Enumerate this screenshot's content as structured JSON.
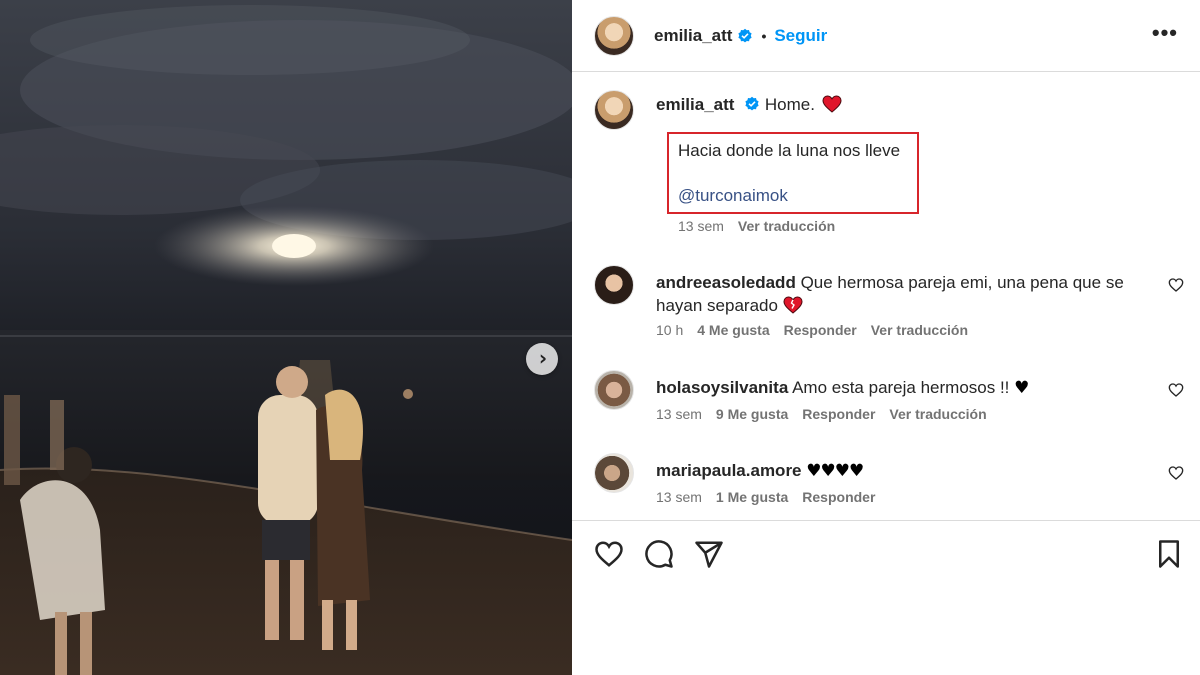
{
  "post": {
    "username": "emilia_att",
    "follow_label": "Seguir",
    "separator": "•",
    "more_label": "•••"
  },
  "caption": {
    "username": "emilia_att",
    "title": "Home.",
    "line1": "Hacia donde la luna nos lleve",
    "mention": "@turconaimok",
    "time": "13 sem",
    "translate": "Ver traducción"
  },
  "comments": [
    {
      "username": "andreeasoledadd",
      "text": "Que hermosa pareja emi, una pena que se hayan separado",
      "emoji": "broken-heart",
      "time": "10 h",
      "likes": "4 Me gusta",
      "reply": "Responder",
      "translate": "Ver traducción"
    },
    {
      "username": "holasoysilvanita",
      "text": "Amo esta pareja hermosos !!",
      "emoji": "black-heart",
      "time": "13 sem",
      "likes": "9 Me gusta",
      "reply": "Responder",
      "translate": "Ver traducción"
    },
    {
      "username": "mariapaula.amore",
      "text": "",
      "emoji": "black-heart x4",
      "time": "13 sem",
      "likes": "1 Me gusta",
      "reply": "Responder"
    }
  ],
  "colors": {
    "accent": "#0095f6",
    "highlight_box": "#d7252b",
    "verified": "#0095f6",
    "heart_red": "#e0162b"
  },
  "icons": [
    "verified-badge-icon",
    "red-heart-icon",
    "broken-heart-icon",
    "black-heart-icon",
    "like-icon",
    "comment-icon",
    "share-icon",
    "save-icon",
    "next-arrow-icon",
    "more-options-icon"
  ]
}
